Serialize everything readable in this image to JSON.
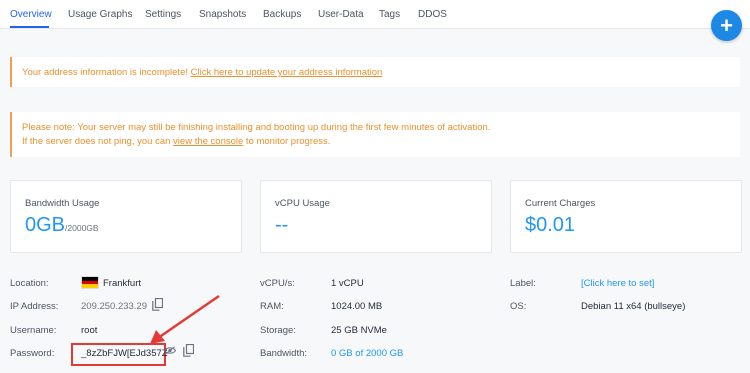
{
  "tabs": [
    "Overview",
    "Usage Graphs",
    "Settings",
    "Snapshots",
    "Backups",
    "User-Data",
    "Tags",
    "DDOS"
  ],
  "fab": {
    "label": "+"
  },
  "alerts": {
    "address": {
      "text": "Your address information is incomplete!",
      "link": "Click here to update your address information"
    },
    "install": {
      "line1": "Please note: Your server may still be finishing installing and booting up during the first few minutes of activation.",
      "line2_pre": "If the server does not ping, you can",
      "line2_link": "view the console",
      "line2_post": "to monitor progress."
    }
  },
  "cards": {
    "bandwidth": {
      "label": "Bandwidth Usage",
      "value": "0GB",
      "unit": "/2000GB"
    },
    "vcpu": {
      "label": "vCPU Usage",
      "value": "--"
    },
    "charges": {
      "label": "Current Charges",
      "value": "$0.01"
    }
  },
  "details": {
    "location": {
      "label": "Location:",
      "value": "Frankfurt",
      "flag_colors": [
        "#000000",
        "#dd0000",
        "#ffce00"
      ]
    },
    "ip": {
      "label": "IP Address:",
      "value": "209.250.233.29"
    },
    "username": {
      "label": "Username:",
      "value": "root"
    },
    "password": {
      "label": "Password:",
      "value": "_8zZbFJW[EJd357Z"
    },
    "vcpus": {
      "label": "vCPU/s:",
      "value": "1 vCPU"
    },
    "ram": {
      "label": "RAM:",
      "value": "1024.00 MB"
    },
    "storage": {
      "label": "Storage:",
      "value": "25 GB NVMe"
    },
    "bandwidth": {
      "label": "Bandwidth:",
      "value": "0 GB of 2000 GB"
    },
    "server_label": {
      "label": "Label:",
      "value": "[Click here to set]"
    },
    "os": {
      "label": "OS:",
      "value": "Debian 11 x64 (bullseye)"
    }
  },
  "colors": {
    "accent": "#2196f3",
    "warning": "#e8912d",
    "highlight": "#e53935"
  }
}
